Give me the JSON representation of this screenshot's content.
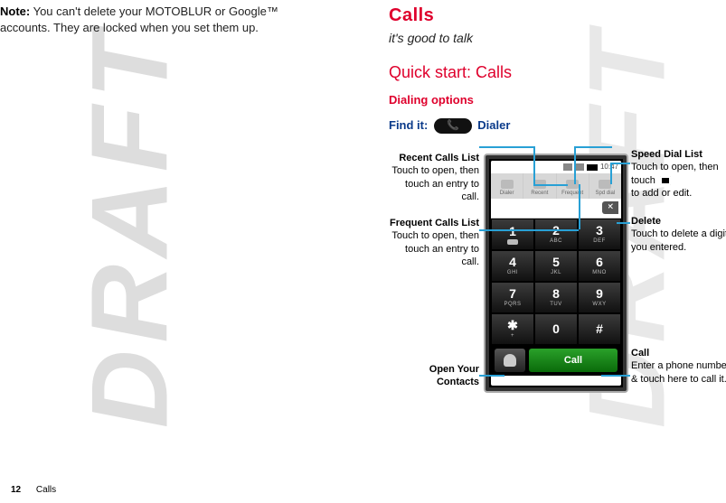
{
  "left_note": {
    "prefix": "Note:",
    "body": " You can't delete your MOTOBLUR or Google™ accounts. They are locked when you set them up."
  },
  "right": {
    "title": "Calls",
    "subtitle": "it's good to talk",
    "quick": "Quick start: Calls",
    "dialing": "Dialing options",
    "findit_label": "Find it:",
    "phone_glyph": "📞",
    "dialer_word": "Dialer"
  },
  "callouts": {
    "recent": {
      "title": "Recent Calls List",
      "body": "Touch to open, then touch an entry to call."
    },
    "frequent": {
      "title": "Frequent Calls List",
      "body": "Touch to open, then touch an entry to call."
    },
    "contacts": {
      "title": "Open Your Contacts"
    },
    "speed": {
      "title": "Speed Dial List",
      "body1": "Touch to open, then touch ",
      "body2": " to add or edit."
    },
    "delete": {
      "title": "Delete",
      "body": "Touch to delete a digit you entered."
    },
    "call": {
      "title": "Call",
      "body": "Enter a phone number & touch here to call it."
    }
  },
  "phone": {
    "time": "10:47",
    "tabs": [
      "Dialer",
      "Recent",
      "Frequent",
      "Spd dial"
    ],
    "delete_glyph": "✕",
    "keys": [
      {
        "n": "1",
        "l": ""
      },
      {
        "n": "2",
        "l": "ABC"
      },
      {
        "n": "3",
        "l": "DEF"
      },
      {
        "n": "4",
        "l": "GHI"
      },
      {
        "n": "5",
        "l": "JKL"
      },
      {
        "n": "6",
        "l": "MNO"
      },
      {
        "n": "7",
        "l": "PQRS"
      },
      {
        "n": "8",
        "l": "TUV"
      },
      {
        "n": "9",
        "l": "WXY"
      },
      {
        "n": "✱",
        "l": "+"
      },
      {
        "n": "0",
        "l": ""
      },
      {
        "n": "#",
        "l": ""
      }
    ],
    "call_label": "Call"
  },
  "footer": {
    "page": "12",
    "section": "Calls"
  },
  "watermark": "DRAFT"
}
